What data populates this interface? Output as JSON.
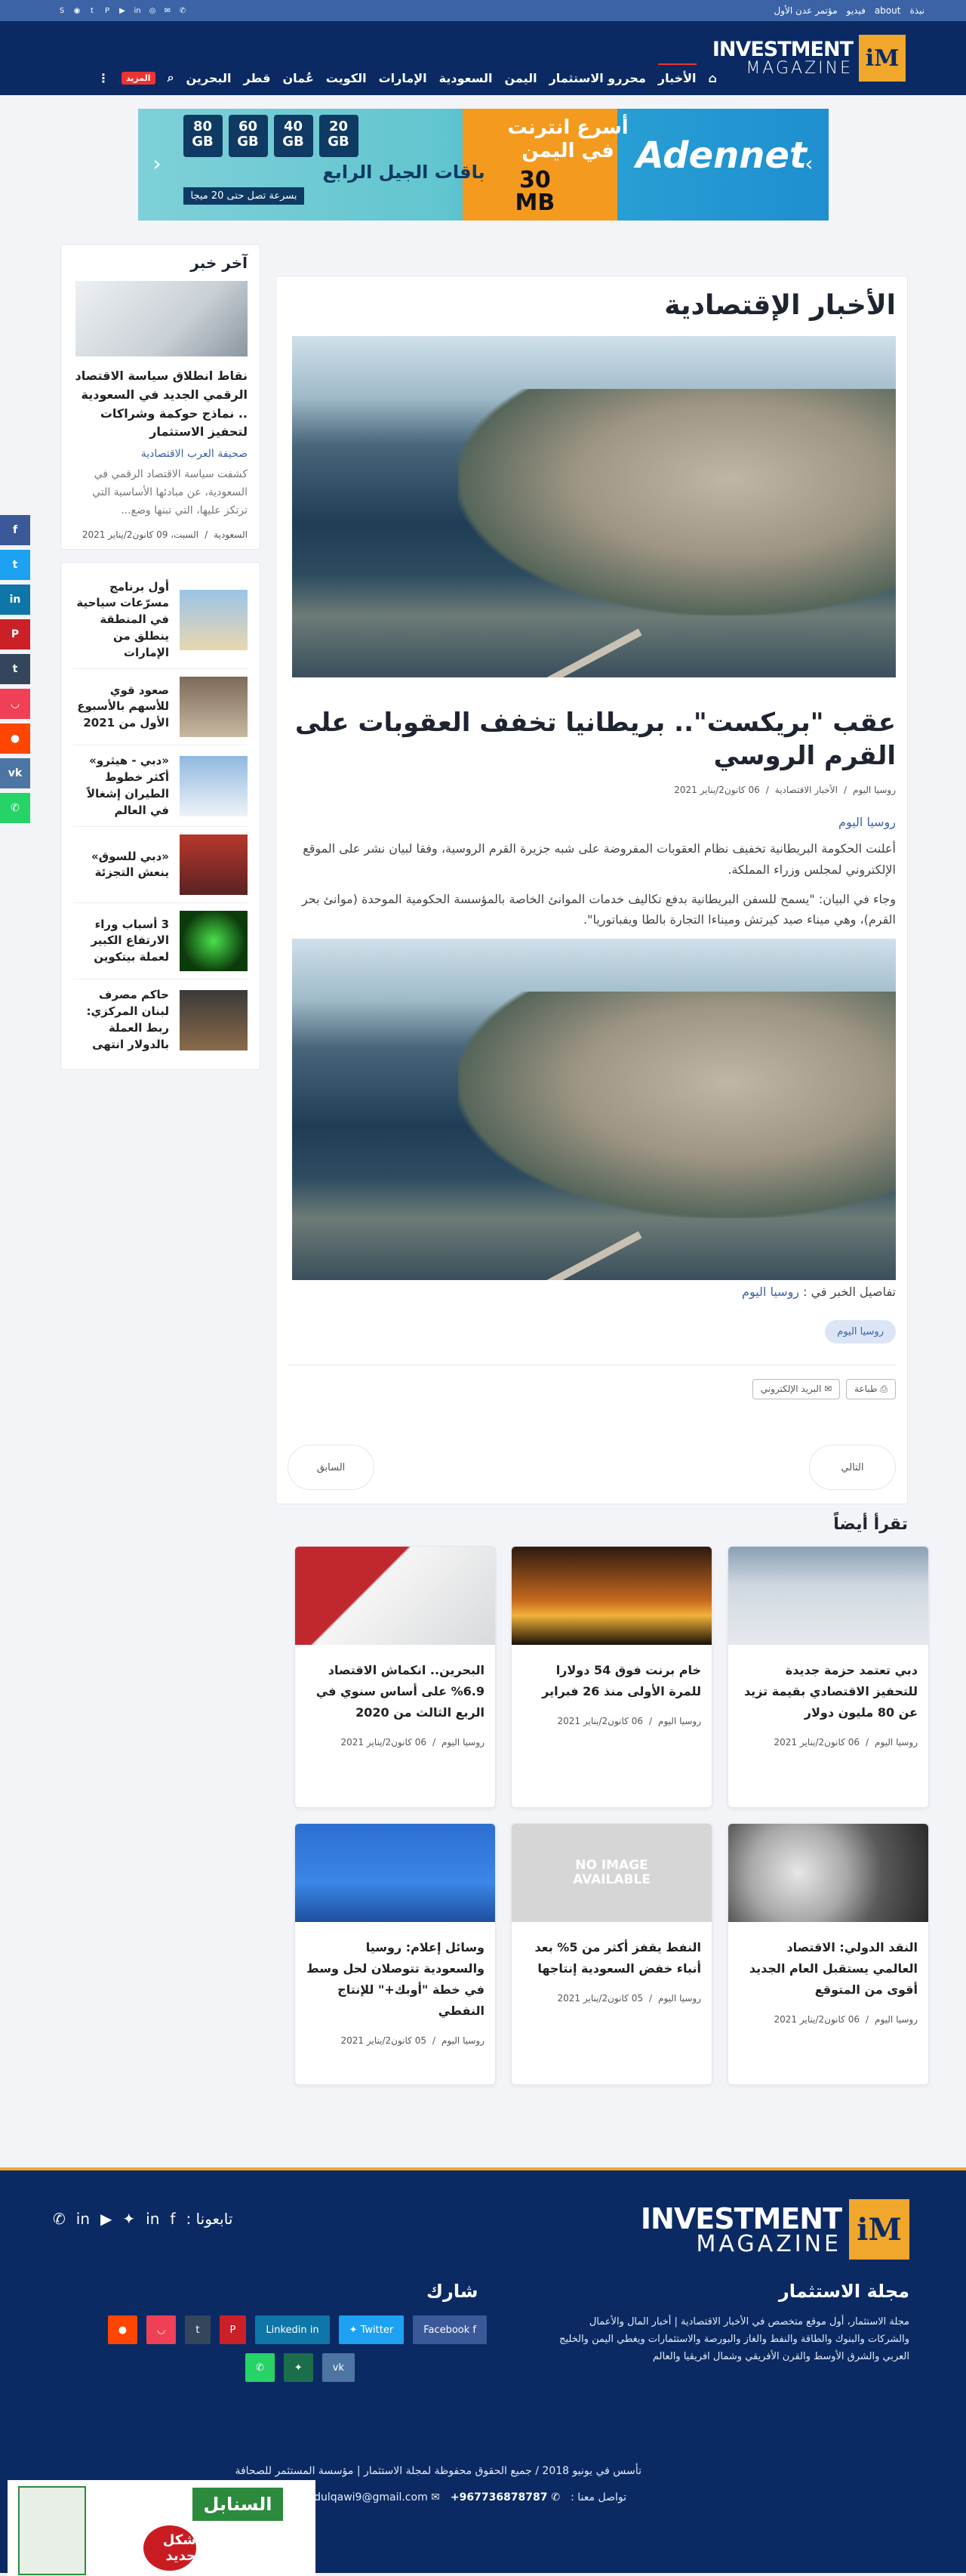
{
  "topbar": {
    "links": [
      "نبذة",
      "about",
      "فيديو",
      "مؤتمر عدن الأول"
    ],
    "socials": [
      "skype-icon",
      "rss-icon",
      "twitter-icon",
      "pinterest-icon",
      "youtube-icon",
      "linkedin-icon",
      "instagram-icon",
      "email-icon",
      "whatsapp-icon"
    ]
  },
  "header": {
    "logo_mark": "iM",
    "logo_word1": "INVESTMENT",
    "logo_word2": "MAGAZINE",
    "nav": [
      "الأخبار",
      "محررو الاستثمار",
      "اليمن",
      "السعودية",
      "الإمارات",
      "الكويت",
      "عُمان",
      "قطر",
      "البحرين"
    ],
    "more": "المزيد"
  },
  "banner": {
    "gbs": [
      "20\nGB",
      "40\nGB",
      "60\nGB",
      "80\nGB"
    ],
    "plan": "باقات الجيل الرابع",
    "slogan": "بسرعة تصل حتى 20 ميجا",
    "yemen": "أسرع انترنت\nفي اليمن",
    "mb": "30\nMB",
    "brand": "Adennet"
  },
  "article": {
    "section_title": "الأخبار الإقتصادية",
    "headline": "عقب \"بريكست\".. بريطانيا تخفف العقوبات على القرم الروسي",
    "meta": [
      "روسيا اليوم",
      "الأخبار الاقتصادية",
      "06 كانون2/يناير 2021"
    ],
    "source": "روسيا اليوم",
    "para1": "أعلنت الحكومة البريطانية تخفيف نظام العقوبات المفروضة على شبه جزيرة القرم الروسية، وفقا لبيان نشر على الموقع الإلكتروني لمجلس وزراء المملكة.",
    "para2": "وجاء في البيان: \"يسمح للسفن البريطانية بدفع تكاليف خدمات الموانئ الخاصة بالمؤسسة الحكومية الموحدة (موانئ بحر القرم)، وهي ميناء صيد كيرتش وميناءا التجارة بالطا ويفباتوريا\".",
    "details_label": "تفاصيل الخبر في :",
    "details_link": "روسيا اليوم",
    "tag": "روسيا اليوم",
    "print": "طباعة",
    "email": "البريد الإلكتروني",
    "next": "التالي",
    "prev": "السابق"
  },
  "related": {
    "title": "تقرأ أيضاً",
    "items": [
      {
        "title": "دبي تعتمد حزمة جديدة للتحفيز الاقتصادي بقيمة تزيد عن 80 مليون دولار",
        "source": "روسيا اليوم",
        "date": "06 كانون2/يناير 2021"
      },
      {
        "title": "خام برنت فوق 54 دولارا للمرة الأولى منذ 26 فبراير",
        "source": "روسيا اليوم",
        "date": "06 كانون2/يناير 2021"
      },
      {
        "title": "البحرين.. انكماش الاقتصاد 6.9% على أساس سنوي في الربع الثالث من 2020",
        "source": "روسيا اليوم",
        "date": "06 كانون2/يناير 2021"
      },
      {
        "title": "النقد الدولي: الاقتصاد العالمي يستقبل العام الجديد أقوى من المتوقع",
        "source": "روسيا اليوم",
        "date": "06 كانون2/يناير 2021"
      },
      {
        "title": "النفط يقفز أكثر من 5% بعد أنباء خفض السعودية إنتاجها",
        "source": "روسيا اليوم",
        "date": "05 كانون2/يناير 2021"
      },
      {
        "title": "وسائل إعلام: روسيا والسعودية تتوصلان لحل وسط في خطة \"أوبك+\" للإنتاج النفطي",
        "source": "روسيا اليوم",
        "date": "05 كانون2/يناير 2021"
      }
    ],
    "no_image": "NO IMAGE\nAVAILABLE"
  },
  "sidebar": {
    "latest_title": "آخر خبر",
    "featured": {
      "title": "نقاط انطلاق سياسة الاقتصاد الرقمي الجديد في السعودية .. نماذج حوكمة وشراكات لتحفيز الاستثمار",
      "source": "صحيفة العرب الاقتصادية",
      "excerpt": "كشفت سياسة الاقتصاد الرقمي في السعودية، عن مبادئها الأساسية التي ترتكز عليها، التي تبنها وضع...",
      "category": "السعودية",
      "date": "السبت، 09 كانون2/يناير 2021"
    },
    "list": [
      "أول برنامج مسرّعات سياحية في المنطقة ينطلق من الإمارات",
      "صعود قوي للأسهم بالأسبوع الأول من 2021",
      "«دبي - هيثرو» أكثر خطوط الطيران إشغالاً في العالم",
      "«دبي للسوق» ينعش التجزئة",
      "3 أسباب وراء الارتفاع الكبير لعملة بيتكوين",
      "حاكم مصرف لبنان المركزي: ربط العملة بالدولار انتهى"
    ]
  },
  "side_social": [
    {
      "icon": "facebook-icon",
      "glyph": "f",
      "color": "#3b5998"
    },
    {
      "icon": "twitter-icon",
      "glyph": "t",
      "color": "#1da1f2"
    },
    {
      "icon": "linkedin-icon",
      "glyph": "in",
      "color": "#0e76a8"
    },
    {
      "icon": "pinterest-icon",
      "glyph": "P",
      "color": "#cb2027"
    },
    {
      "icon": "tumblr-icon",
      "glyph": "t",
      "color": "#35465c"
    },
    {
      "icon": "pocket-icon",
      "glyph": "◡",
      "color": "#ef4056"
    },
    {
      "icon": "reddit-icon",
      "glyph": "●",
      "color": "#ff4500"
    },
    {
      "icon": "vk-icon",
      "glyph": "vk",
      "color": "#4c75a3"
    },
    {
      "icon": "whatsapp-icon",
      "glyph": "✆",
      "color": "#25d366"
    }
  ],
  "footer": {
    "logo_mark": "iM",
    "logo_word1": "INVESTMENT",
    "logo_word2": "MAGAZINE",
    "follow": "تابعونا :",
    "about_title": "مجلة الاستثمار",
    "about": "مجلة الاستثمار، أول موقع متخصص في الأخبار الاقتصادية | أخبار المال والأعمال والشركات والبنوك والطاقة والنفط والغاز والبورصة والاستثمارات ويغطي اليمن والخليج العربي والشرق الأوسط والقرن الأفريقي وشمال افريقيا والعالم",
    "share_title": "شارك",
    "shares": [
      {
        "label": "Facebook f",
        "color": "#3b5998"
      },
      {
        "label": "Twitter ✦",
        "color": "#1da1f2"
      },
      {
        "label": "Linkedin in",
        "color": "#0e76a8"
      },
      {
        "label": "P",
        "color": "#cb2027"
      },
      {
        "label": "t",
        "color": "#35465c"
      },
      {
        "label": "◡",
        "color": "#ef4056"
      },
      {
        "label": "●",
        "color": "#ff4500"
      },
      {
        "label": "vk",
        "color": "#4c75a3"
      },
      {
        "label": "✦",
        "color": "#1c6e4a"
      },
      {
        "label": "✆",
        "color": "#25d366"
      }
    ],
    "copyright": "تأسس في يونيو 2018 / جميع الحقوق محفوظة لمجلة الاستثمار | مؤسسة المستثمر للصحافة",
    "contact_label": "تواصل معنا :",
    "phone": "+967736878787",
    "email": "abdulqawi9@gmail.com",
    "ad_brand": "السنابل",
    "ad_new": "شكل جديد"
  },
  "colors": {
    "navy": "#0b2a63",
    "topbar": "#3b63a6",
    "accent": "#f0a72b",
    "link": "#3b63a6"
  }
}
